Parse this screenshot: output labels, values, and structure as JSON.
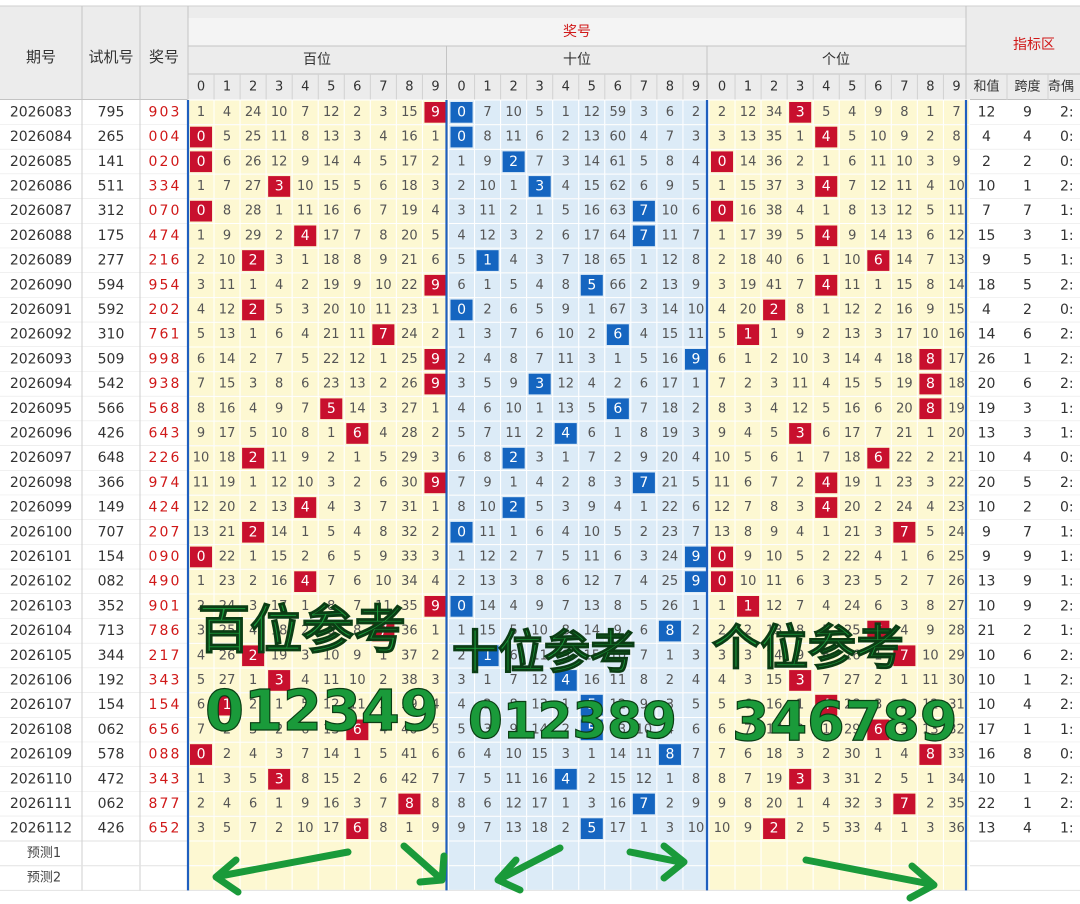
{
  "header": {
    "issue_label": "期号",
    "trial_label": "试机号",
    "prize_label": "奖号",
    "prize_group_label": "奖号",
    "hundreds_label": "百位",
    "tens_label": "十位",
    "units_label": "个位",
    "index_zone_label": "指标区",
    "sum_label": "和值",
    "span_label": "跨度",
    "odd_label": "奇偶"
  },
  "digit_labels": [
    "0",
    "1",
    "2",
    "3",
    "4",
    "5",
    "6",
    "7",
    "8",
    "9"
  ],
  "forecast_labels": [
    "预测1",
    "预测2"
  ],
  "colors": {
    "hit_red": "#c8102e",
    "hit_blue": "#1565c0",
    "cell_yellow": "#fdf8d2",
    "cell_blue": "#dcebf7",
    "header_gray": "#ececec",
    "prize_red": "#d01818",
    "handwriting_green": "#1a9a3a",
    "handwriting_dark": "#0b3d14"
  },
  "rows": [
    {
      "issue": "2026083",
      "trial": "795",
      "prize": "903",
      "h": [
        1,
        4,
        24,
        10,
        7,
        12,
        2,
        3,
        15,
        9
      ],
      "t": [
        0,
        7,
        10,
        5,
        1,
        12,
        59,
        3,
        6,
        2
      ],
      "u": [
        2,
        12,
        34,
        3,
        5,
        4,
        9,
        8,
        1,
        7
      ],
      "sum": "12",
      "span": "9",
      "odd": "2:"
    },
    {
      "issue": "2026084",
      "trial": "265",
      "prize": "004",
      "h": [
        0,
        5,
        25,
        11,
        8,
        13,
        3,
        4,
        16,
        1
      ],
      "t": [
        0,
        8,
        11,
        6,
        2,
        13,
        60,
        4,
        7,
        3
      ],
      "u": [
        3,
        13,
        35,
        1,
        4,
        5,
        10,
        9,
        2,
        8
      ],
      "sum": "4",
      "span": "4",
      "odd": "0:"
    },
    {
      "issue": "2026085",
      "trial": "141",
      "prize": "020",
      "h": [
        0,
        6,
        26,
        12,
        9,
        14,
        4,
        5,
        17,
        2
      ],
      "t": [
        1,
        9,
        2,
        7,
        3,
        14,
        61,
        5,
        8,
        4
      ],
      "u": [
        0,
        14,
        36,
        2,
        1,
        6,
        11,
        10,
        3,
        9
      ],
      "sum": "2",
      "span": "2",
      "odd": "0:"
    },
    {
      "issue": "2026086",
      "trial": "511",
      "prize": "334",
      "h": [
        1,
        7,
        27,
        3,
        10,
        15,
        5,
        6,
        18,
        3
      ],
      "t": [
        2,
        10,
        1,
        3,
        4,
        15,
        62,
        6,
        9,
        5
      ],
      "u": [
        1,
        15,
        37,
        3,
        4,
        7,
        12,
        11,
        4,
        10
      ],
      "sum": "10",
      "span": "1",
      "odd": "2:"
    },
    {
      "issue": "2026087",
      "trial": "312",
      "prize": "070",
      "h": [
        0,
        8,
        28,
        1,
        11,
        16,
        6,
        7,
        19,
        4
      ],
      "t": [
        3,
        11,
        2,
        1,
        5,
        16,
        63,
        7,
        10,
        6
      ],
      "u": [
        0,
        16,
        38,
        4,
        1,
        8,
        13,
        12,
        5,
        11
      ],
      "sum": "7",
      "span": "7",
      "odd": "1:"
    },
    {
      "issue": "2026088",
      "trial": "175",
      "prize": "474",
      "h": [
        1,
        9,
        29,
        2,
        4,
        17,
        7,
        8,
        20,
        5
      ],
      "t": [
        4,
        12,
        3,
        2,
        6,
        17,
        64,
        7,
        11,
        7
      ],
      "u": [
        1,
        17,
        39,
        5,
        4,
        9,
        14,
        13,
        6,
        12
      ],
      "sum": "15",
      "span": "3",
      "odd": "1:"
    },
    {
      "issue": "2026089",
      "trial": "277",
      "prize": "216",
      "h": [
        2,
        10,
        2,
        3,
        1,
        18,
        8,
        9,
        21,
        6
      ],
      "t": [
        5,
        1,
        4,
        3,
        7,
        18,
        65,
        1,
        12,
        8
      ],
      "u": [
        2,
        18,
        40,
        6,
        1,
        10,
        6,
        14,
        7,
        13
      ],
      "sum": "9",
      "span": "5",
      "odd": "1:"
    },
    {
      "issue": "2026090",
      "trial": "594",
      "prize": "954",
      "h": [
        3,
        11,
        1,
        4,
        2,
        19,
        9,
        10,
        22,
        9
      ],
      "t": [
        6,
        1,
        5,
        4,
        8,
        5,
        66,
        2,
        13,
        9
      ],
      "u": [
        3,
        19,
        41,
        7,
        4,
        11,
        1,
        15,
        8,
        14
      ],
      "sum": "18",
      "span": "5",
      "odd": "2:"
    },
    {
      "issue": "2026091",
      "trial": "592",
      "prize": "202",
      "h": [
        4,
        12,
        2,
        5,
        3,
        20,
        10,
        11,
        23,
        1
      ],
      "t": [
        0,
        2,
        6,
        5,
        9,
        1,
        67,
        3,
        14,
        10
      ],
      "u": [
        4,
        20,
        2,
        8,
        1,
        12,
        2,
        16,
        9,
        15
      ],
      "sum": "4",
      "span": "2",
      "odd": "0:"
    },
    {
      "issue": "2026092",
      "trial": "310",
      "prize": "761",
      "h": [
        5,
        13,
        1,
        6,
        4,
        21,
        11,
        7,
        24,
        2
      ],
      "t": [
        1,
        3,
        7,
        6,
        10,
        2,
        6,
        4,
        15,
        11
      ],
      "u": [
        5,
        1,
        1,
        9,
        2,
        13,
        3,
        17,
        10,
        16
      ],
      "sum": "14",
      "span": "6",
      "odd": "2:"
    },
    {
      "issue": "2026093",
      "trial": "509",
      "prize": "998",
      "h": [
        6,
        14,
        2,
        7,
        5,
        22,
        12,
        1,
        25,
        9
      ],
      "t": [
        2,
        4,
        8,
        7,
        11,
        3,
        1,
        5,
        16,
        9
      ],
      "u": [
        6,
        1,
        2,
        10,
        3,
        14,
        4,
        18,
        8,
        17
      ],
      "sum": "26",
      "span": "1",
      "odd": "2:"
    },
    {
      "issue": "2026094",
      "trial": "542",
      "prize": "938",
      "h": [
        7,
        15,
        3,
        8,
        6,
        23,
        13,
        2,
        26,
        9
      ],
      "t": [
        3,
        5,
        9,
        3,
        12,
        4,
        2,
        6,
        17,
        1
      ],
      "u": [
        7,
        2,
        3,
        11,
        4,
        15,
        5,
        19,
        8,
        18
      ],
      "sum": "20",
      "span": "6",
      "odd": "2:"
    },
    {
      "issue": "2026095",
      "trial": "566",
      "prize": "568",
      "h": [
        8,
        16,
        4,
        9,
        7,
        5,
        14,
        3,
        27,
        1
      ],
      "t": [
        4,
        6,
        10,
        1,
        13,
        5,
        6,
        7,
        18,
        2
      ],
      "u": [
        8,
        3,
        4,
        12,
        5,
        16,
        6,
        20,
        8,
        19
      ],
      "sum": "19",
      "span": "3",
      "odd": "1:"
    },
    {
      "issue": "2026096",
      "trial": "426",
      "prize": "643",
      "h": [
        9,
        17,
        5,
        10,
        8,
        1,
        6,
        4,
        28,
        2
      ],
      "t": [
        5,
        7,
        11,
        2,
        4,
        6,
        1,
        8,
        19,
        3
      ],
      "u": [
        9,
        4,
        5,
        3,
        6,
        17,
        7,
        21,
        1,
        20
      ],
      "sum": "13",
      "span": "3",
      "odd": "1:"
    },
    {
      "issue": "2026097",
      "trial": "648",
      "prize": "226",
      "h": [
        10,
        18,
        2,
        11,
        9,
        2,
        1,
        5,
        29,
        3
      ],
      "t": [
        6,
        8,
        2,
        3,
        1,
        7,
        2,
        9,
        20,
        4
      ],
      "u": [
        10,
        5,
        6,
        1,
        7,
        18,
        6,
        22,
        2,
        21
      ],
      "sum": "10",
      "span": "4",
      "odd": "0:"
    },
    {
      "issue": "2026098",
      "trial": "366",
      "prize": "974",
      "h": [
        11,
        19,
        1,
        12,
        10,
        3,
        2,
        6,
        30,
        9
      ],
      "t": [
        7,
        9,
        1,
        4,
        2,
        8,
        3,
        7,
        21,
        5
      ],
      "u": [
        11,
        6,
        7,
        2,
        4,
        19,
        1,
        23,
        3,
        22
      ],
      "sum": "20",
      "span": "5",
      "odd": "2:"
    },
    {
      "issue": "2026099",
      "trial": "149",
      "prize": "424",
      "h": [
        12,
        20,
        2,
        13,
        4,
        4,
        3,
        7,
        31,
        1
      ],
      "t": [
        8,
        10,
        2,
        5,
        3,
        9,
        4,
        1,
        22,
        6
      ],
      "u": [
        12,
        7,
        8,
        3,
        4,
        20,
        2,
        24,
        4,
        23
      ],
      "sum": "10",
      "span": "2",
      "odd": "0:"
    },
    {
      "issue": "2026100",
      "trial": "707",
      "prize": "207",
      "h": [
        13,
        21,
        2,
        14,
        1,
        5,
        4,
        8,
        32,
        2
      ],
      "t": [
        0,
        11,
        1,
        6,
        4,
        10,
        5,
        2,
        23,
        7
      ],
      "u": [
        13,
        8,
        9,
        4,
        1,
        21,
        3,
        7,
        5,
        24
      ],
      "sum": "9",
      "span": "7",
      "odd": "1:"
    },
    {
      "issue": "2026101",
      "trial": "154",
      "prize": "090",
      "h": [
        0,
        22,
        1,
        15,
        2,
        6,
        5,
        9,
        33,
        3
      ],
      "t": [
        1,
        12,
        2,
        7,
        5,
        11,
        6,
        3,
        24,
        9
      ],
      "u": [
        0,
        9,
        10,
        5,
        2,
        22,
        4,
        1,
        6,
        25
      ],
      "sum": "9",
      "span": "9",
      "odd": "1:"
    },
    {
      "issue": "2026102",
      "trial": "082",
      "prize": "490",
      "h": [
        1,
        23,
        2,
        16,
        4,
        7,
        6,
        10,
        34,
        4
      ],
      "t": [
        2,
        13,
        3,
        8,
        6,
        12,
        7,
        4,
        25,
        9
      ],
      "u": [
        0,
        10,
        11,
        6,
        3,
        23,
        5,
        2,
        7,
        26
      ],
      "sum": "13",
      "span": "9",
      "odd": "1:"
    },
    {
      "issue": "2026103",
      "trial": "352",
      "prize": "901",
      "h": [
        2,
        24,
        3,
        17,
        1,
        8,
        7,
        11,
        35,
        9
      ],
      "t": [
        0,
        14,
        4,
        9,
        7,
        13,
        8,
        5,
        26,
        1
      ],
      "u": [
        1,
        1,
        12,
        7,
        4,
        24,
        6,
        3,
        8,
        27
      ],
      "sum": "10",
      "span": "9",
      "odd": "2:"
    },
    {
      "issue": "2026104",
      "trial": "713",
      "prize": "786",
      "h": [
        3,
        25,
        4,
        18,
        2,
        9,
        8,
        7,
        36,
        1
      ],
      "t": [
        1,
        15,
        5,
        10,
        8,
        14,
        9,
        6,
        8,
        2
      ],
      "u": [
        2,
        2,
        13,
        8,
        5,
        25,
        6,
        4,
        9,
        28
      ],
      "sum": "21",
      "span": "2",
      "odd": "1:"
    },
    {
      "issue": "2026105",
      "trial": "344",
      "prize": "217",
      "h": [
        4,
        26,
        2,
        19,
        3,
        10,
        9,
        1,
        37,
        2
      ],
      "t": [
        2,
        1,
        6,
        11,
        9,
        15,
        10,
        7,
        1,
        3
      ],
      "u": [
        3,
        3,
        14,
        9,
        6,
        26,
        1,
        7,
        10,
        29
      ],
      "sum": "10",
      "span": "6",
      "odd": "2:"
    },
    {
      "issue": "2026106",
      "trial": "192",
      "prize": "343",
      "h": [
        5,
        27,
        1,
        3,
        4,
        11,
        10,
        2,
        38,
        3
      ],
      "t": [
        3,
        1,
        7,
        12,
        4,
        16,
        11,
        8,
        2,
        4
      ],
      "u": [
        4,
        3,
        15,
        3,
        7,
        27,
        2,
        1,
        11,
        30
      ],
      "sum": "10",
      "span": "1",
      "odd": "2:"
    },
    {
      "issue": "2026107",
      "trial": "154",
      "prize": "154",
      "h": [
        6,
        1,
        2,
        1,
        5,
        12,
        11,
        3,
        39,
        4
      ],
      "t": [
        4,
        2,
        8,
        13,
        1,
        5,
        12,
        9,
        3,
        5
      ],
      "u": [
        5,
        6,
        16,
        1,
        4,
        28,
        3,
        2,
        12,
        31
      ],
      "sum": "10",
      "span": "4",
      "odd": "2:"
    },
    {
      "issue": "2026108",
      "trial": "062",
      "prize": "656",
      "h": [
        7,
        2,
        3,
        2,
        6,
        13,
        6,
        4,
        40,
        5
      ],
      "t": [
        5,
        3,
        9,
        14,
        2,
        5,
        13,
        10,
        4,
        6
      ],
      "u": [
        6,
        7,
        17,
        2,
        1,
        29,
        6,
        3,
        13,
        32
      ],
      "sum": "17",
      "span": "1",
      "odd": "1:"
    },
    {
      "issue": "2026109",
      "trial": "578",
      "prize": "088",
      "h": [
        0,
        2,
        4,
        3,
        7,
        14,
        1,
        5,
        41,
        6
      ],
      "t": [
        6,
        4,
        10,
        15,
        3,
        1,
        14,
        11,
        8,
        7
      ],
      "u": [
        7,
        6,
        18,
        3,
        2,
        30,
        1,
        4,
        8,
        33
      ],
      "sum": "16",
      "span": "8",
      "odd": "0:"
    },
    {
      "issue": "2026110",
      "trial": "472",
      "prize": "343",
      "h": [
        1,
        3,
        5,
        3,
        8,
        15,
        2,
        6,
        42,
        7
      ],
      "t": [
        7,
        5,
        11,
        16,
        4,
        2,
        15,
        12,
        1,
        8
      ],
      "u": [
        8,
        7,
        19,
        3,
        3,
        31,
        2,
        5,
        1,
        34
      ],
      "sum": "10",
      "span": "1",
      "odd": "2:"
    },
    {
      "issue": "2026111",
      "trial": "062",
      "prize": "877",
      "h": [
        2,
        4,
        6,
        1,
        9,
        16,
        3,
        7,
        8,
        8
      ],
      "t": [
        8,
        6,
        12,
        17,
        1,
        3,
        16,
        7,
        2,
        9
      ],
      "u": [
        9,
        8,
        20,
        1,
        4,
        32,
        3,
        7,
        2,
        35
      ],
      "sum": "22",
      "span": "1",
      "odd": "2:"
    },
    {
      "issue": "2026112",
      "trial": "426",
      "prize": "652",
      "h": [
        3,
        5,
        7,
        2,
        10,
        17,
        6,
        8,
        1,
        9
      ],
      "t": [
        9,
        7,
        13,
        18,
        2,
        5,
        17,
        1,
        3,
        10
      ],
      "u": [
        10,
        9,
        2,
        2,
        5,
        33,
        4,
        1,
        3,
        36
      ],
      "sum": "13",
      "span": "4",
      "odd": "1:"
    }
  ],
  "overlay": {
    "hundreds_ref_title": "百位参考",
    "hundreds_ref_digits": "012349",
    "tens_ref_title": "十位参考",
    "tens_ref_digits": "012389",
    "units_ref_title": "个位参考",
    "units_ref_digits": "346789"
  }
}
